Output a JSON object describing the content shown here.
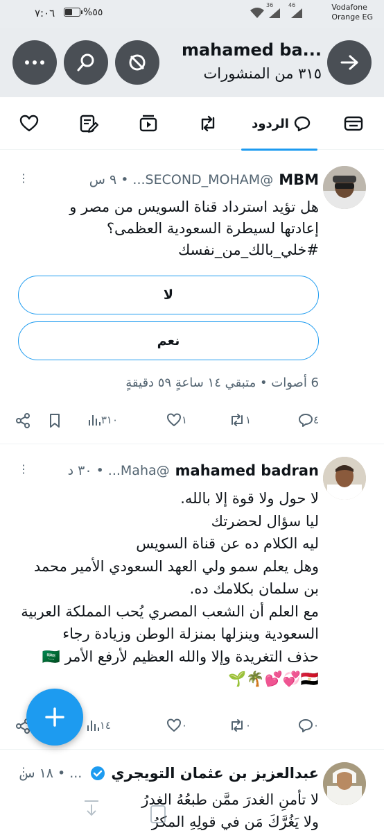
{
  "status_bar": {
    "time": "٧:٠٦",
    "battery_percent": "%٥٥",
    "battery_level": 0.55,
    "signal_labels": [
      "36",
      "46"
    ],
    "carrier_line1": "Vodafone",
    "carrier_line2": "Orange EG"
  },
  "header": {
    "title": "mahamed ba...",
    "subtitle": "٣١٥ من المنشورات",
    "icons": [
      "back-arrow-icon",
      "hide-icon",
      "search-icon",
      "more-icon"
    ]
  },
  "tabs": [
    {
      "label": "",
      "icon": "summary-icon"
    },
    {
      "label": "الردود",
      "icon": "reply-icon",
      "active": true
    },
    {
      "label": "",
      "icon": "repost-icon"
    },
    {
      "label": "",
      "icon": "media-icon"
    },
    {
      "label": "",
      "icon": "highlights-icon"
    },
    {
      "label": "",
      "icon": "likes-icon"
    }
  ],
  "tweets": [
    {
      "name": "MBM",
      "handle": "@SECOND_MOHAM...",
      "time": "٩ س",
      "dot": "•",
      "more": "⋮",
      "text_lines": [
        "هل تؤيد استرداد قناة السويس من مصر و",
        "إعادتها لسيطرة السعودية العظمى؟",
        "#خلي_بالك_من_نفسك"
      ],
      "poll": {
        "options": [
          "لا",
          "نعم"
        ],
        "info": "6 أصوات • متبقي ١٤ ساعةٍ ٥٩ دقيقةٍ"
      },
      "actions": {
        "replies": "٤",
        "reposts": "١",
        "likes": "١",
        "views": "٣١٠"
      }
    },
    {
      "name": "mahamed badran",
      "handle": "@Maha...",
      "time": "٣٠ د",
      "dot": "•",
      "more": "⋮",
      "text_lines": [
        "لا حول ولا قوة إلا بالله.",
        "ليا سؤال لحضرتك",
        "ليه الكلام ده عن قناة السويس",
        "وهل يعلم سمو ولي العهد السعودي الأمير محمد",
        "بن سلمان بكلامك ده.",
        "مع العلم أن الشعب المصري يُحب المملكة العربية",
        "السعودية وينزلها بمنزلة الوطن وزيادة رجاء",
        "حذف التغريدة وإلا والله العظيم لأرفع الأمر 🇸🇦",
        "🇪🇬💞💕🌴🌱"
      ],
      "actions": {
        "replies": "٠",
        "reposts": "٠",
        "likes": "٠",
        "views": "١٤"
      }
    },
    {
      "name": "عبدالعزيز بن عثمان التويجري",
      "handle": "...",
      "time": "١٨ س",
      "dot": "•",
      "more": "⋮",
      "text_lines": [
        "لا تأمنِ الغدرَ ممَّن طبعُهُ الغدرُ",
        "ولا يَغُرَّكَ مَن في قولِهِ المكرُ"
      ]
    }
  ],
  "fab": {
    "label": "+"
  },
  "colors": {
    "accent": "#1d9bf0",
    "secondary_text": "#536471",
    "header_bg": "#e9ecef",
    "header_btn": "#4a4f55"
  }
}
